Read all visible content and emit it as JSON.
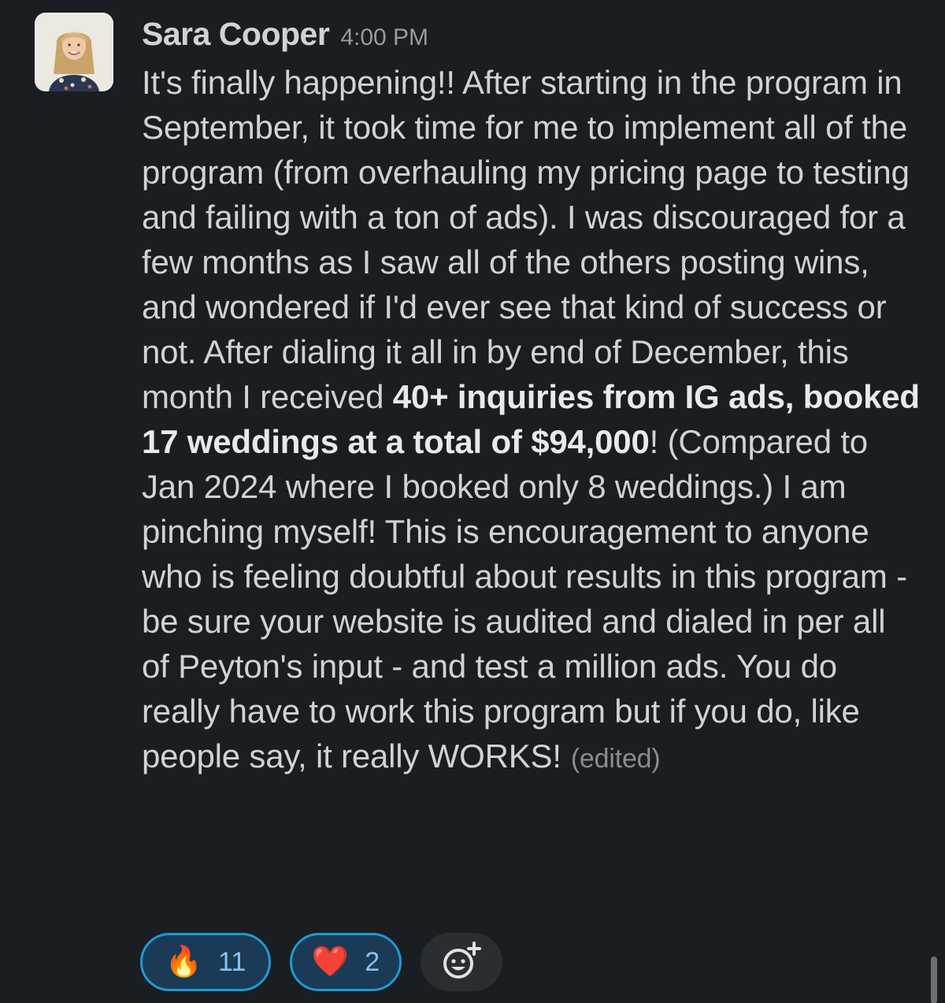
{
  "message": {
    "author": "Sara Cooper",
    "timestamp": "4:00 PM",
    "body": {
      "part1": "It's finally happening!! After starting in the program in September, it took time for me to implement all of the program (from overhauling my pricing page to testing and failing with a ton of ads). I was discouraged for a few months as I saw all of the others posting wins, and wondered if I'd ever see that kind of success or not. After dialing it all in by end of December, this month I received ",
      "bold": "40+ inquiries from IG ads, booked 17 weddings at a total of $94,000",
      "part2": "! (Compared to Jan 2024 where I booked only 8 weddings.) I am pinching myself! This is encouragement to anyone who is feeling doubtful about results in this program - be sure your website is audited and dialed in per all of Peyton's input - and test a million ads. You do really have to work this program but if you do, like people say, it really WORKS!"
    },
    "edited_label": "(edited)"
  },
  "reactions": [
    {
      "emoji": "🔥",
      "icon": "fire-icon",
      "count": "11"
    },
    {
      "emoji": "❤️",
      "icon": "heart-icon",
      "count": "2"
    }
  ],
  "add_reaction_icon": "add-reaction-icon",
  "colors": {
    "background": "#1a1d21",
    "text": "#d1d2d3",
    "reaction_border": "#1d9bd1",
    "reaction_bg": "#1b3a55",
    "reaction_count": "#86c3f0"
  }
}
